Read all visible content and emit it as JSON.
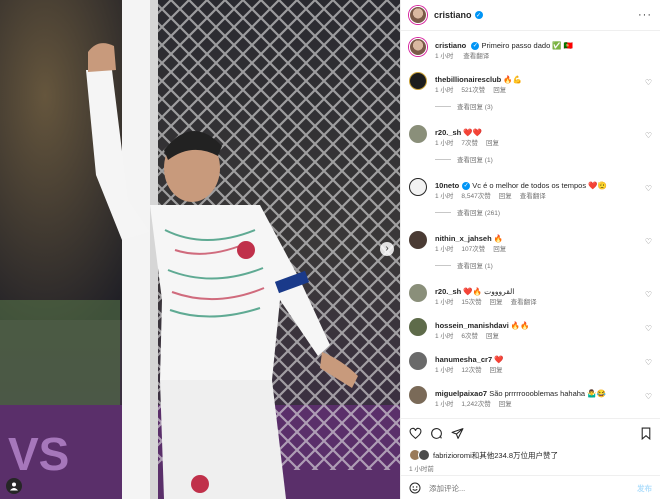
{
  "header": {
    "username": "cristiano",
    "more": "···"
  },
  "caption": {
    "username": "cristiano",
    "text": "Primeiro passo dado ✅ 🇵🇹",
    "time": "1 小时",
    "translate": "查看翻译"
  },
  "comments": [
    {
      "username": "thebillionairesclub",
      "text": "🔥💪",
      "time": "1 小时",
      "likes": "521次赞",
      "reply": "回复",
      "view_replies": "查看回复 (3)",
      "avatar_color": "#1d1d1d"
    },
    {
      "username": "r20._sh",
      "text": "❤️❤️",
      "time": "1 小时",
      "likes": "7次赞",
      "reply": "回复",
      "view_replies": "查看回复 (1)",
      "avatar_color": "#8a8f7a"
    },
    {
      "username": "10neto",
      "text": "Vc é o melhor de todos os tempos ❤️🫡",
      "time": "1 小时",
      "likes": "8,547次赞",
      "reply": "回复",
      "translate": "查看翻译",
      "view_replies": "查看回复 (261)",
      "avatar_color": "#f2f2f2",
      "verified": true
    },
    {
      "username": "nithin_x_jahseh",
      "text": "🔥",
      "time": "1 小时",
      "likes": "107次赞",
      "reply": "回复",
      "view_replies": "查看回复 (1)",
      "avatar_color": "#4a3b34"
    },
    {
      "username": "r20._sh",
      "text": "❤️🔥 القروووت",
      "time": "1 小时",
      "likes": "15次赞",
      "reply": "回复",
      "translate": "查看翻译",
      "avatar_color": "#8a8f7a"
    },
    {
      "username": "hossein_manishdavi",
      "text": "🔥🔥",
      "time": "1 小时",
      "likes": "6次赞",
      "reply": "回复",
      "avatar_color": "#5e6b4a"
    },
    {
      "username": "hanumesha_cr7",
      "text": "❤️",
      "time": "1 小时",
      "likes": "12次赞",
      "reply": "回复",
      "avatar_color": "#6a6a6a"
    },
    {
      "username": "miguelpaixao7",
      "text": "São prrrrroooblemas hahaha 🤷‍♂️😂",
      "time": "1 小时",
      "likes": "1,242次赞",
      "reply": "回复",
      "avatar_color": "#7a6a58"
    }
  ],
  "actions": {
    "likes_text": "fabrizioromi和其他234.8万位用户赞了",
    "time": "1 小时前"
  },
  "add_comment": {
    "placeholder": "添加评论...",
    "post": "发布"
  },
  "colors": {
    "accent": "#0095f6",
    "muted": "#737373"
  }
}
